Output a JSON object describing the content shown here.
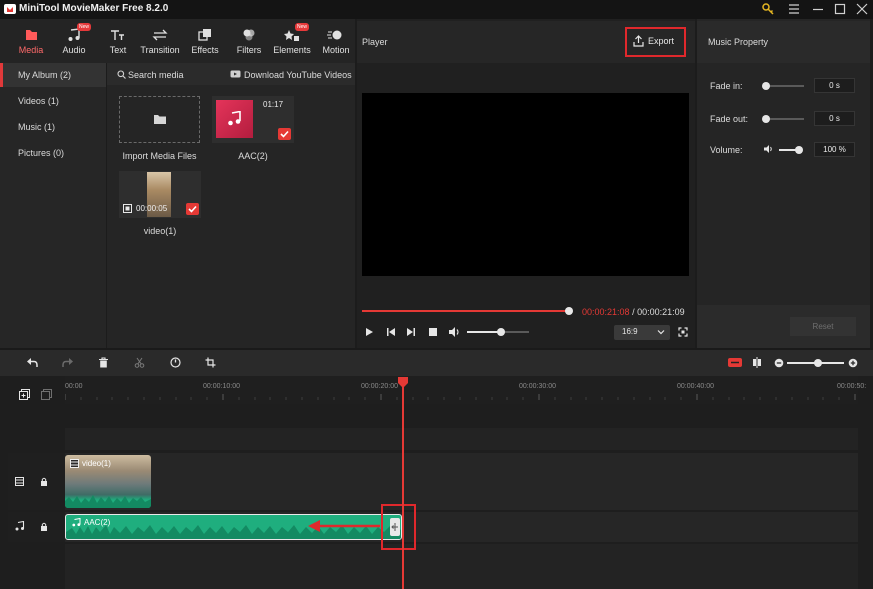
{
  "app": {
    "title": "MiniTool MovieMaker Free 8.2.0"
  },
  "toolbar": {
    "items": [
      {
        "label": "Media",
        "icon": "folder-icon"
      },
      {
        "label": "Audio",
        "icon": "music-note-icon",
        "badge": "New"
      },
      {
        "label": "Text",
        "icon": "text-icon"
      },
      {
        "label": "Transition",
        "icon": "transition-icon"
      },
      {
        "label": "Effects",
        "icon": "effects-icon"
      },
      {
        "label": "Filters",
        "icon": "filters-icon"
      },
      {
        "label": "Elements",
        "icon": "elements-icon",
        "badge": "New"
      },
      {
        "label": "Motion",
        "icon": "motion-icon"
      }
    ],
    "active_color": "#ff5a5a"
  },
  "album": {
    "items": [
      "My Album (2)",
      "Videos (1)",
      "Music (1)",
      "Pictures (0)"
    ]
  },
  "media": {
    "search_label": "Search media",
    "download_label": "Download YouTube Videos",
    "import_label": "Import Media Files",
    "items": [
      {
        "name": "AAC(2)",
        "duration": "01:17"
      },
      {
        "name": "video(1)",
        "duration": "00:00:05"
      }
    ]
  },
  "player": {
    "title": "Player",
    "export_label": "Export",
    "current_time": "00:00:21:08",
    "separator": "/",
    "total_time": "00:00:21:09",
    "progress": 1.0,
    "volume_level": 0.55,
    "aspect": "16:9"
  },
  "property": {
    "title": "Music Property",
    "fade_in_label": "Fade in:",
    "fade_in_value": "0 s",
    "fade_out_label": "Fade out:",
    "fade_out_value": "0 s",
    "volume_label": "Volume:",
    "volume_value": "100 %",
    "reset_label": "Reset"
  },
  "timeline": {
    "ticks": [
      "00:00",
      "00:00:10:00",
      "00:00:20:00",
      "00:00:30:00",
      "00:00:40:00",
      "00:00:50:"
    ],
    "video_clip": "video(1)",
    "audio_clip": "AAC(2)",
    "zoom_level": 0.55
  },
  "colors": {
    "accent": "#e53935",
    "clip_green": "#1fae7e",
    "playhead": "#e53935"
  }
}
